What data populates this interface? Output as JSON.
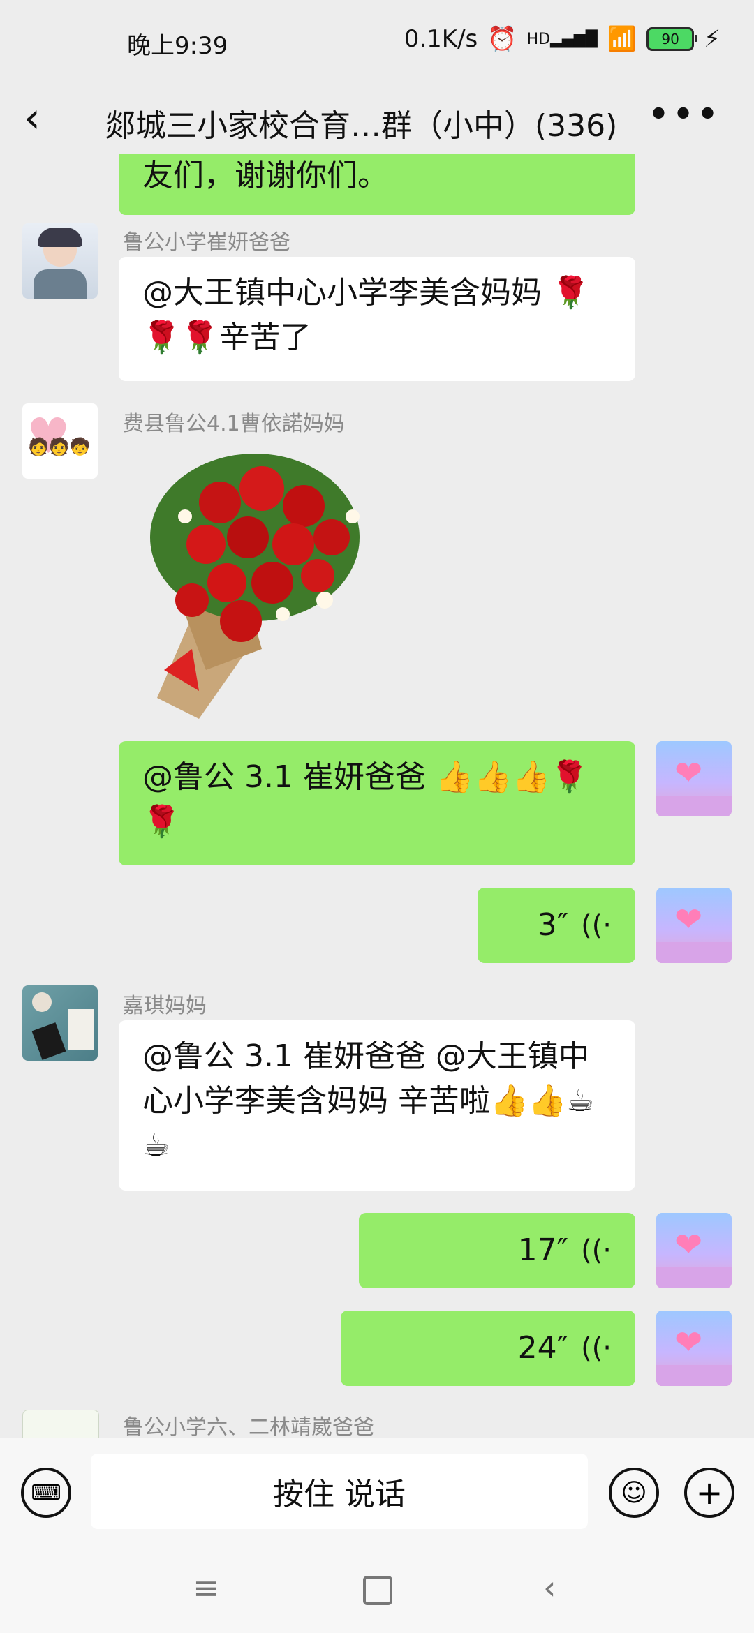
{
  "status_bar": {
    "time": "晚上9:39",
    "network_speed": "0.1K/s",
    "signal_label": "HD",
    "battery": "90"
  },
  "header": {
    "title": "郯城三小家校合育…群（小中）(336)"
  },
  "messages": [
    {
      "type": "text",
      "side": "right",
      "text": "友们，谢谢你们。"
    },
    {
      "type": "text",
      "side": "left",
      "sender": "鲁公小学崔妍爸爸",
      "text": "@大王镇中心小学李美含妈妈 🌹🌹🌹辛苦了"
    },
    {
      "type": "image",
      "side": "left",
      "sender": "费县鲁公4.1曹依諾妈妈",
      "image": "rose-bouquet"
    },
    {
      "type": "text",
      "side": "right",
      "text": "@鲁公 3.1 崔妍爸爸 👍👍👍🌹🌹"
    },
    {
      "type": "voice",
      "side": "right",
      "duration": "3″"
    },
    {
      "type": "text",
      "side": "left",
      "sender": "嘉琪妈妈",
      "text": "@鲁公 3.1 崔妍爸爸 @大王镇中心小学李美含妈妈  辛苦啦👍👍☕☕"
    },
    {
      "type": "voice",
      "side": "right",
      "duration": "17″"
    },
    {
      "type": "voice",
      "side": "right",
      "duration": "24″"
    },
    {
      "type": "name_only",
      "side": "left",
      "sender": "鲁公小学六、二林靖崴爸爸"
    }
  ],
  "input_bar": {
    "hold_to_talk": "按住 说话"
  },
  "icons": {
    "back": "chevron-left-icon",
    "more": "more-dots-icon",
    "keyboard": "keyboard-icon",
    "emoji": "emoji-icon",
    "plus": "plus-icon",
    "voice_wave": "voice-wave-icon"
  },
  "colors": {
    "background": "#ededed",
    "self_bubble": "#95ec69",
    "other_bubble": "#ffffff"
  }
}
